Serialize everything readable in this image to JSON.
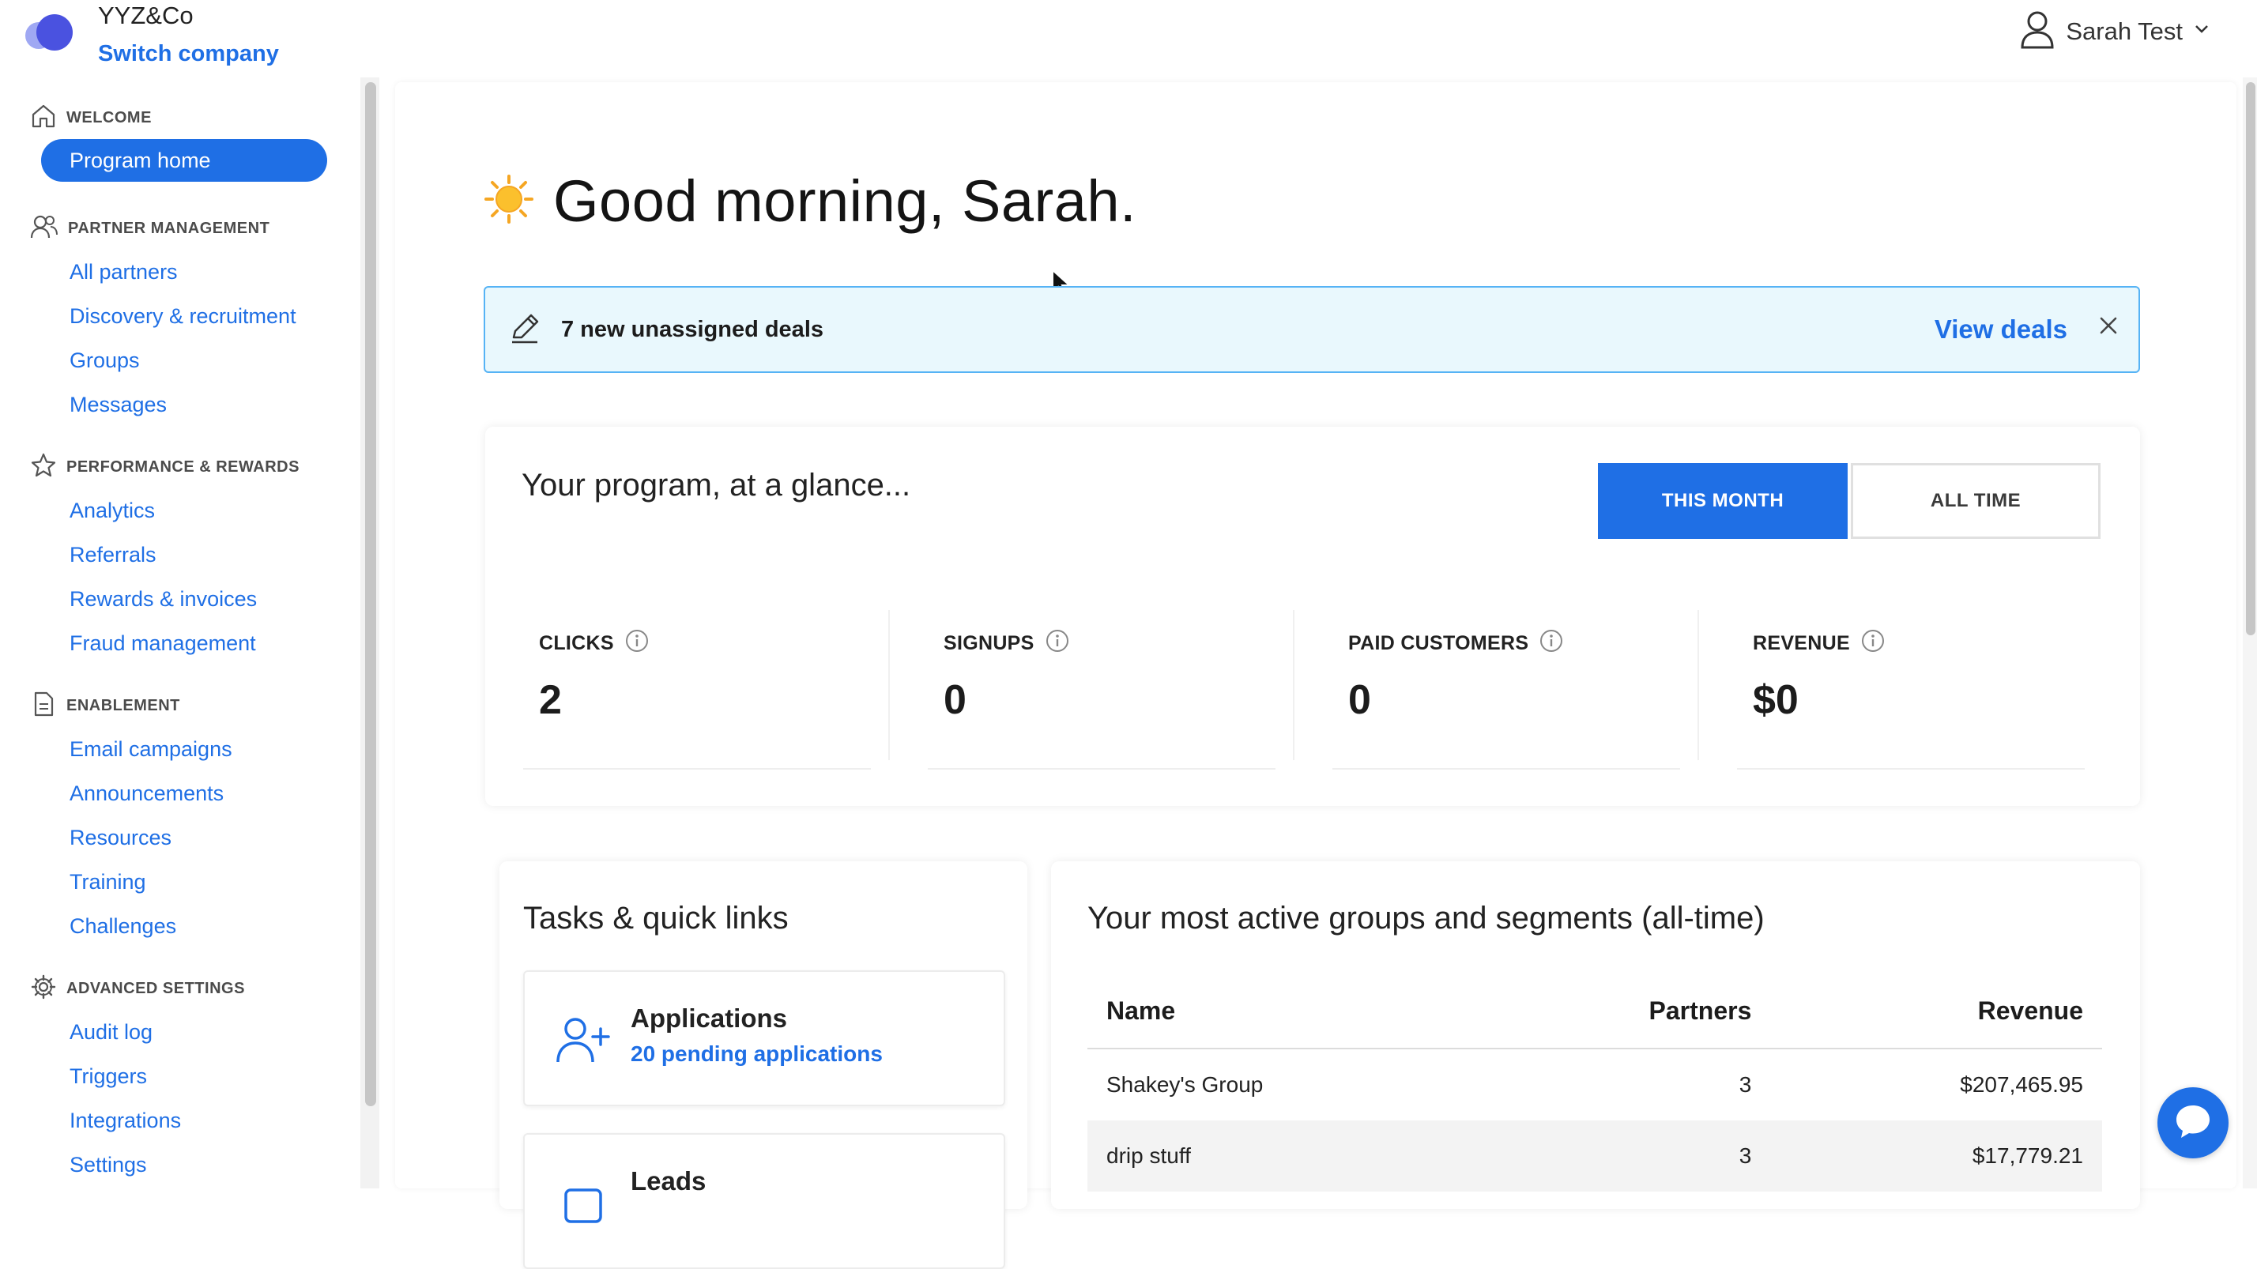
{
  "company": {
    "name": "YYZ&Co",
    "switch_label": "Switch company"
  },
  "user": {
    "name": "Sarah Test"
  },
  "sidebar": {
    "sections": [
      {
        "label": "WELCOME",
        "icon": "home-icon",
        "items": [
          "Program home"
        ]
      },
      {
        "label": "PARTNER MANAGEMENT",
        "icon": "users-icon",
        "items": [
          "All partners",
          "Discovery & recruitment",
          "Groups",
          "Messages"
        ]
      },
      {
        "label": "PERFORMANCE & REWARDS",
        "icon": "star-icon",
        "items": [
          "Analytics",
          "Referrals",
          "Rewards & invoices",
          "Fraud management"
        ]
      },
      {
        "label": "ENABLEMENT",
        "icon": "document-icon",
        "items": [
          "Email campaigns",
          "Announcements",
          "Resources",
          "Training",
          "Challenges"
        ]
      },
      {
        "label": "ADVANCED SETTINGS",
        "icon": "gear-icon",
        "items": [
          "Audit log",
          "Triggers",
          "Integrations",
          "Settings"
        ]
      }
    ],
    "active_item": "Program home"
  },
  "greeting": {
    "emoji": "☀️",
    "text": "Good morning, Sarah."
  },
  "banner": {
    "message": "7 new unassigned deals",
    "action": "View deals"
  },
  "glance": {
    "title": "Your program, at a glance...",
    "toggle": [
      "THIS MONTH",
      "ALL TIME"
    ],
    "active_toggle": "THIS MONTH",
    "stats": [
      {
        "label": "CLICKS",
        "value": "2"
      },
      {
        "label": "SIGNUPS",
        "value": "0"
      },
      {
        "label": "PAID CUSTOMERS",
        "value": "0"
      },
      {
        "label": "REVENUE",
        "value": "$0"
      }
    ]
  },
  "tasks": {
    "title": "Tasks & quick links",
    "items": [
      {
        "name": "Applications",
        "link": "20 pending applications",
        "icon": "user-plus-icon"
      },
      {
        "name": "Leads",
        "link": "",
        "icon": "leads-icon"
      }
    ]
  },
  "groups": {
    "title": "Your most active groups and segments (all-time)",
    "columns": [
      "Name",
      "Partners",
      "Revenue"
    ],
    "rows": [
      [
        "Shakey's Group",
        "3",
        "$207,465.95"
      ],
      [
        "drip stuff",
        "3",
        "$17,779.21"
      ]
    ]
  },
  "colors": {
    "accent": "#1f6fe5",
    "banner_bg": "#e9f8fd",
    "banner_border": "#56b3f5"
  }
}
